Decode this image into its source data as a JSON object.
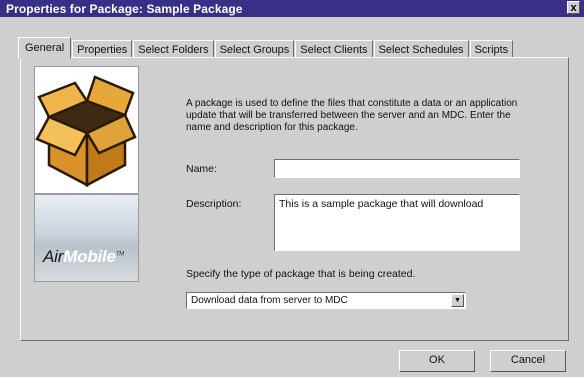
{
  "window": {
    "title": "Properties for Package: Sample Package",
    "close_label": "x"
  },
  "tabs": [
    {
      "label": "General",
      "active": true
    },
    {
      "label": "Properties"
    },
    {
      "label": "Select Folders"
    },
    {
      "label": "Select Groups"
    },
    {
      "label": "Select Clients"
    },
    {
      "label": "Select Schedules"
    },
    {
      "label": "Scripts"
    }
  ],
  "logo": {
    "air": "Air",
    "mobile": "Mobile",
    "tm": "TM"
  },
  "general": {
    "intro": "A package is used to define the files that constitute a data or an application update that will be transferred between the server and an MDC. Enter the name and description for this package.",
    "name_label": "Name:",
    "name_value": "",
    "description_label": "Description:",
    "description_value": "This is a sample package that will download",
    "type_prompt": "Specify the type of package that is being created.",
    "type_value": "Download data from server to MDC"
  },
  "buttons": {
    "ok": "OK",
    "cancel": "Cancel"
  },
  "colors": {
    "titlebar": "#3a2f86",
    "dialog_bg": "#cfcfcf"
  }
}
